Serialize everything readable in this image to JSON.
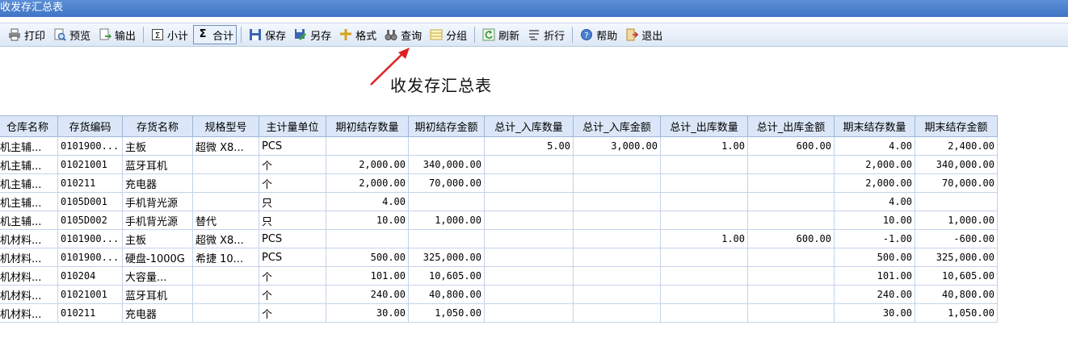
{
  "window": {
    "title": "收发存汇总表"
  },
  "toolbar": {
    "items": [
      {
        "label": "打印",
        "icon": "printer-icon"
      },
      {
        "label": "预览",
        "icon": "preview-icon"
      },
      {
        "label": "输出",
        "icon": "export-icon"
      },
      {
        "label": "小计",
        "icon": "subtotal-icon"
      },
      {
        "label": "合计",
        "icon": "sigma-icon"
      },
      {
        "label": "保存",
        "icon": "save-icon"
      },
      {
        "label": "另存",
        "icon": "save-as-icon"
      },
      {
        "label": "格式",
        "icon": "format-icon"
      },
      {
        "label": "查询",
        "icon": "binoculars-icon"
      },
      {
        "label": "分组",
        "icon": "group-icon"
      },
      {
        "label": "刷新",
        "icon": "refresh-icon"
      },
      {
        "label": "折行",
        "icon": "wrap-icon"
      },
      {
        "label": "帮助",
        "icon": "help-icon"
      },
      {
        "label": "退出",
        "icon": "exit-icon"
      }
    ]
  },
  "report": {
    "title": "收发存汇总表"
  },
  "grid": {
    "columns": [
      "仓库名称",
      "存货编码",
      "存货名称",
      "规格型号",
      "主计量单位",
      "期初结存数量",
      "期初结存金额",
      "总计_入库数量",
      "总计_入库金额",
      "总计_出库数量",
      "总计_出库金额",
      "期末结存数量",
      "期末结存金额"
    ],
    "rows": [
      [
        "机主辅...",
        "0101900...",
        "主板",
        "超微 X8...",
        "PCS",
        "",
        "",
        "5.00",
        "3,000.00",
        "1.00",
        "600.00",
        "4.00",
        "2,400.00"
      ],
      [
        "机主辅...",
        "01021001",
        "蓝牙耳机",
        "",
        "个",
        "2,000.00",
        "340,000.00",
        "",
        "",
        "",
        "",
        "2,000.00",
        "340,000.00"
      ],
      [
        "机主辅...",
        "010211",
        "充电器",
        "",
        "个",
        "2,000.00",
        "70,000.00",
        "",
        "",
        "",
        "",
        "2,000.00",
        "70,000.00"
      ],
      [
        "机主辅...",
        "0105D001",
        "手机背光源",
        "",
        "只",
        "4.00",
        "",
        "",
        "",
        "",
        "",
        "4.00",
        ""
      ],
      [
        "机主辅...",
        "0105D002",
        "手机背光源",
        "替代",
        "只",
        "10.00",
        "1,000.00",
        "",
        "",
        "",
        "",
        "10.00",
        "1,000.00"
      ],
      [
        "机材料...",
        "0101900...",
        "主板",
        "超微 X8...",
        "PCS",
        "",
        "",
        "",
        "",
        "1.00",
        "600.00",
        "-1.00",
        "-600.00"
      ],
      [
        "机材料...",
        "0101900...",
        "硬盘-1000G",
        "希捷 10...",
        "PCS",
        "500.00",
        "325,000.00",
        "",
        "",
        "",
        "",
        "500.00",
        "325,000.00"
      ],
      [
        "机材料...",
        "010204",
        "大容量...",
        "",
        "个",
        "101.00",
        "10,605.00",
        "",
        "",
        "",
        "",
        "101.00",
        "10,605.00"
      ],
      [
        "机材料...",
        "01021001",
        "蓝牙耳机",
        "",
        "个",
        "240.00",
        "40,800.00",
        "",
        "",
        "",
        "",
        "240.00",
        "40,800.00"
      ],
      [
        "机材料...",
        "010211",
        "充电器",
        "",
        "个",
        "30.00",
        "1,050.00",
        "",
        "",
        "",
        "",
        "30.00",
        "1,050.00"
      ]
    ]
  }
}
